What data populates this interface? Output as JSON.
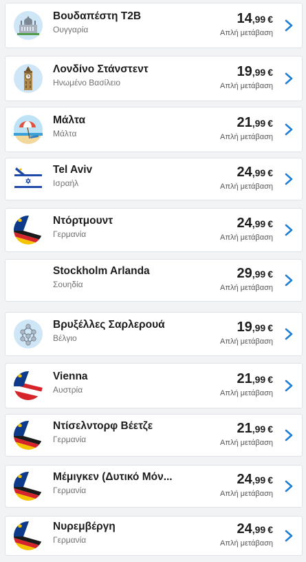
{
  "flights": [
    {
      "city": "Βουδαπέστη T2B",
      "country": "Ουγγαρία",
      "price_int": "14",
      "price_dec": ",99",
      "currency": "€",
      "note": "Απλή μετάβαση",
      "icon": "budapest-parliament-icon"
    },
    {
      "city": "Λονδίνο Στάνστεντ",
      "country": "Ηνωμένο Βασίλειο",
      "price_int": "19",
      "price_dec": ",99",
      "currency": "€",
      "note": "Απλή μετάβαση",
      "icon": "big-ben-icon"
    },
    {
      "city": "Μάλτα",
      "country": "Μάλτα",
      "price_int": "21",
      "price_dec": ",99",
      "currency": "€",
      "note": "Απλή μετάβαση",
      "icon": "beach-umbrella-icon"
    },
    {
      "city": "Tel Aviv",
      "country": "Ισραήλ",
      "price_int": "24",
      "price_dec": ",99",
      "currency": "€",
      "note": "Απλή μετάβαση",
      "icon": "israel-flag-plane-icon"
    },
    {
      "city": "Ντόρτμουντ",
      "country": "Γερμανία",
      "price_int": "24",
      "price_dec": ",99",
      "currency": "€",
      "note": "Απλή μετάβαση",
      "icon": "germany-flag-plane-icon"
    },
    {
      "city": "Stockholm Arlanda",
      "country": "Σουηδία",
      "price_int": "29",
      "price_dec": ",99",
      "currency": "€",
      "note": "Απλή μετάβαση",
      "icon": ""
    },
    {
      "city": "Βρυξέλλες Σαρλερουά",
      "country": "Βέλγιο",
      "price_int": "19",
      "price_dec": ",99",
      "currency": "€",
      "note": "Απλή μετάβαση",
      "icon": "atomium-icon"
    },
    {
      "city": "Vienna",
      "country": "Αυστρία",
      "price_int": "21",
      "price_dec": ",99",
      "currency": "€",
      "note": "Απλή μετάβαση",
      "icon": "austria-flag-plane-icon"
    },
    {
      "city": "Ντίσελντορφ Βέετζε",
      "country": "Γερμανία",
      "price_int": "21",
      "price_dec": ",99",
      "currency": "€",
      "note": "Απλή μετάβαση",
      "icon": "germany-flag-plane-icon"
    },
    {
      "city": "Μέμιγκεν (Δυτικό Μόν...",
      "country": "Γερμανία",
      "price_int": "24",
      "price_dec": ",99",
      "currency": "€",
      "note": "Απλή μετάβαση",
      "icon": "germany-flag-plane-icon"
    },
    {
      "city": "Νυρεμβέργη",
      "country": "Γερμανία",
      "price_int": "24",
      "price_dec": ",99",
      "currency": "€",
      "note": "Απλή μετάβαση",
      "icon": "germany-flag-plane-icon"
    }
  ],
  "colors": {
    "accent": "#1e7fd6",
    "text": "#1c1c1c",
    "muted": "#707070"
  }
}
